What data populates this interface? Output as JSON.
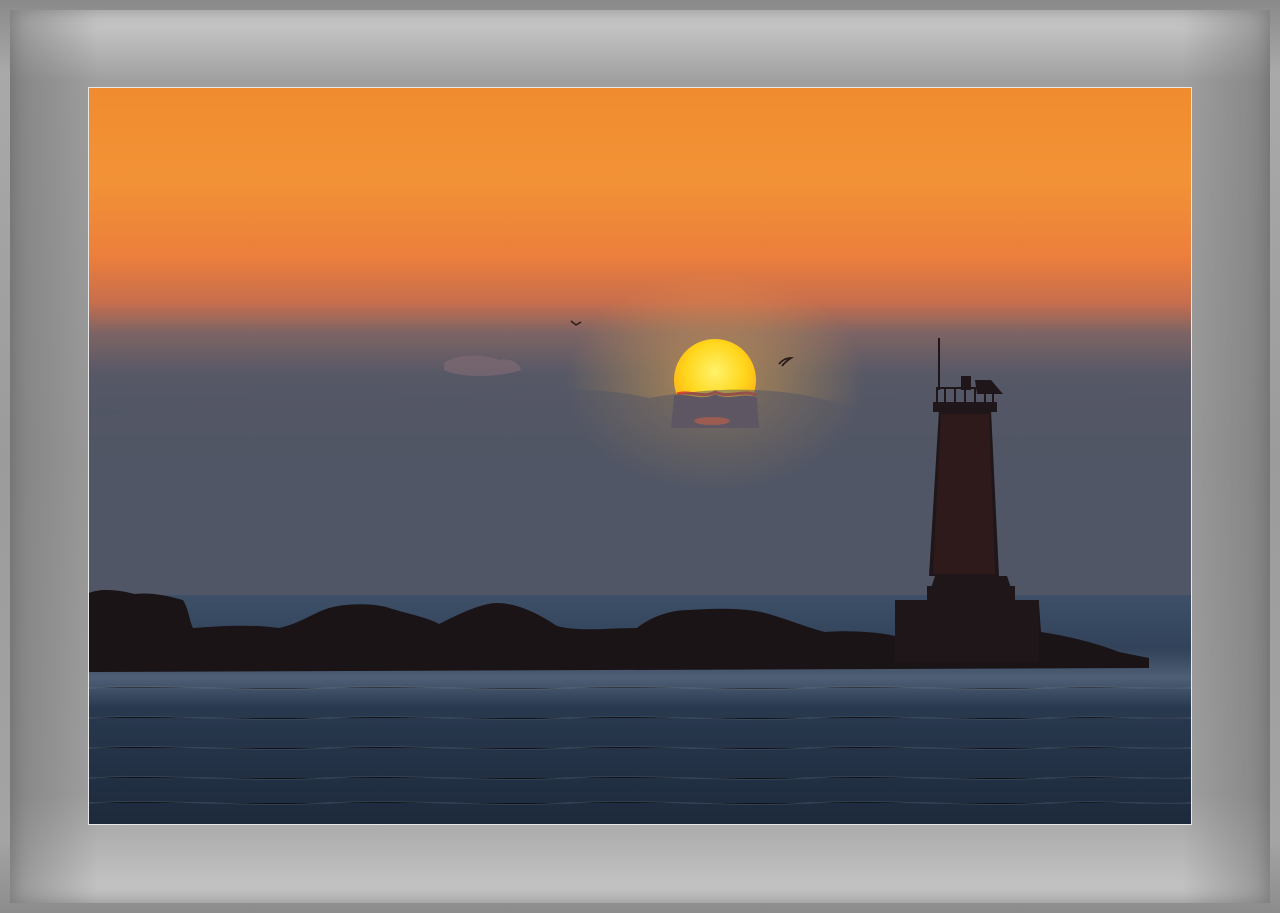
{
  "photo": {
    "subject": "sunset-lighthouse-seascape",
    "colors": {
      "sky_top": "#f08a30",
      "sky_mid": "#e8763a",
      "haze": "#5b5a66",
      "sea": "#2b3a4d",
      "sun": "#ffd21f",
      "silhouette": "#1c1416"
    }
  }
}
